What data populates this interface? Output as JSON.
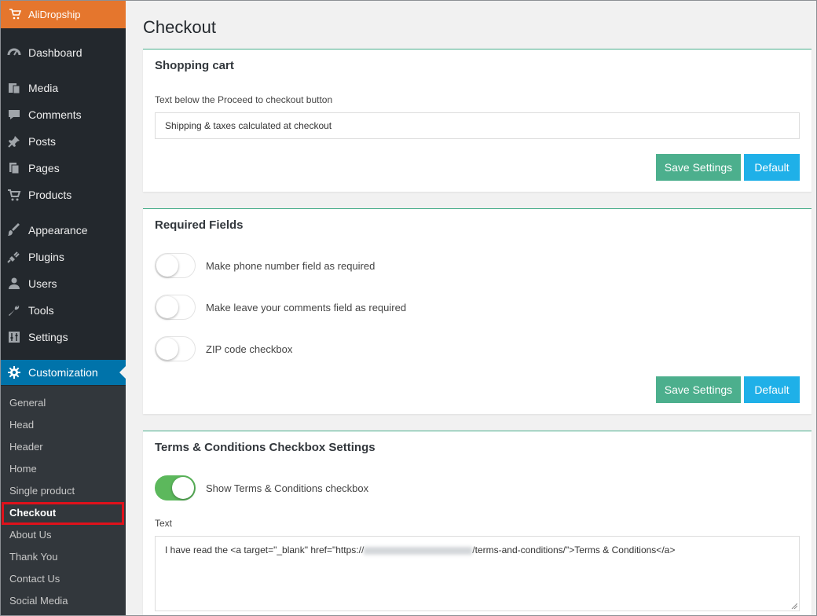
{
  "brand": {
    "name": "AliDropship",
    "icon": "cart-icon",
    "color": "#e5762d"
  },
  "sidebar": {
    "items": [
      {
        "label": "Dashboard",
        "icon": "dashboard-icon"
      },
      {
        "label": "Media",
        "icon": "media-icon"
      },
      {
        "label": "Comments",
        "icon": "comments-icon"
      },
      {
        "label": "Posts",
        "icon": "pin-icon"
      },
      {
        "label": "Pages",
        "icon": "pages-icon"
      },
      {
        "label": "Products",
        "icon": "cart-icon"
      },
      {
        "label": "Appearance",
        "icon": "brush-icon"
      },
      {
        "label": "Plugins",
        "icon": "plugin-icon"
      },
      {
        "label": "Users",
        "icon": "user-icon"
      },
      {
        "label": "Tools",
        "icon": "wrench-icon"
      },
      {
        "label": "Settings",
        "icon": "settings-sliders-icon"
      },
      {
        "label": "Customization",
        "icon": "gear-icon",
        "active": true
      }
    ],
    "submenu": [
      {
        "label": "General"
      },
      {
        "label": "Head"
      },
      {
        "label": "Header"
      },
      {
        "label": "Home"
      },
      {
        "label": "Single product"
      },
      {
        "label": "Checkout",
        "current": true
      },
      {
        "label": "About Us"
      },
      {
        "label": "Thank You"
      },
      {
        "label": "Contact Us"
      },
      {
        "label": "Social Media"
      }
    ]
  },
  "page": {
    "title": "Checkout"
  },
  "shopping_cart": {
    "title": "Shopping cart",
    "field_label": "Text below the Proceed to checkout button",
    "field_value": "Shipping & taxes calculated at checkout",
    "save_label": "Save Settings",
    "default_label": "Default"
  },
  "required_fields": {
    "title": "Required Fields",
    "toggles": [
      {
        "label": "Make phone number field as required",
        "on": false
      },
      {
        "label": "Make leave your comments field as required",
        "on": false
      },
      {
        "label": "ZIP code checkbox",
        "on": false
      }
    ],
    "save_label": "Save Settings",
    "default_label": "Default"
  },
  "terms": {
    "title": "Terms & Conditions Checkbox Settings",
    "toggle_label": "Show Terms & Conditions checkbox",
    "toggle_on": true,
    "text_label": "Text",
    "text_before": "I have read the <a target=\"_blank\" href=\"https://",
    "text_after": "/terms-and-conditions/\">Terms & Conditions</a>"
  },
  "colors": {
    "save": "#4caf8d",
    "default": "#1fb0e8",
    "active_menu": "#0073aa",
    "toggle_on": "#5cb85c",
    "highlight": "#e0111b"
  }
}
